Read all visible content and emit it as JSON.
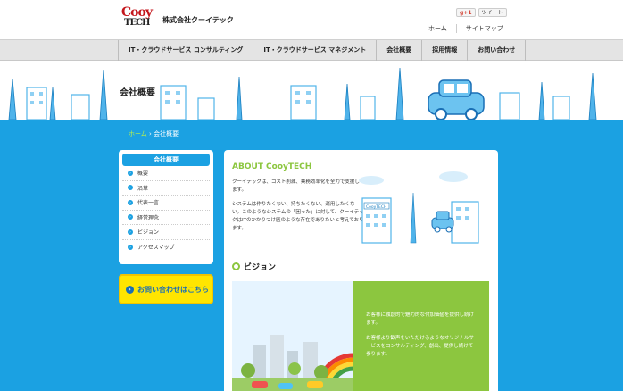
{
  "header": {
    "logo_line1": "Cooy",
    "logo_line2": "TECH",
    "company_name": "株式会社クーイテック",
    "share_gplus": "g+1",
    "share_tweet": "ツイート",
    "util_links": [
      "ホーム",
      "サイトマップ"
    ]
  },
  "nav": {
    "items": [
      "IT・クラウドサービス コンサルティング",
      "IT・クラウドサービス マネジメント",
      "会社概要",
      "採用情報",
      "お問い合わせ"
    ]
  },
  "banner": {
    "title": "会社概要"
  },
  "breadcrumb": {
    "home": "ホーム",
    "separator": "›",
    "current": "会社概要"
  },
  "sidebar": {
    "heading": "会社概要",
    "items": [
      "概要",
      "沿革",
      "代表一言",
      "経営理念",
      "ビジョン",
      "アクセスマップ"
    ],
    "contact_label": "お問い合わせはこちら"
  },
  "about": {
    "title": "ABOUT CooyTECH",
    "p1": "クーイテックは、コスト削減、業務効率化を全力で支援します。",
    "p2": "システムは作りたくない、持ちたくない、運用したくない。このようなシステムの「困った」に対して、クーイテックはITのかかりつけ医のような存在でありたいと考えております。",
    "building_sign": "CooyTECH"
  },
  "vision": {
    "title": "ビジョン",
    "p1": "お客様に独創的で魅力的な付加価値を提供し続けます。",
    "p2": "お客様より歓声をいただけるようなオリジナルサービスをコンサルティング、創出、提供し続けて参ります。"
  },
  "colors": {
    "main_blue": "#1ba1e2",
    "accent_green": "#8cc63f",
    "yellow": "#ffe500"
  }
}
